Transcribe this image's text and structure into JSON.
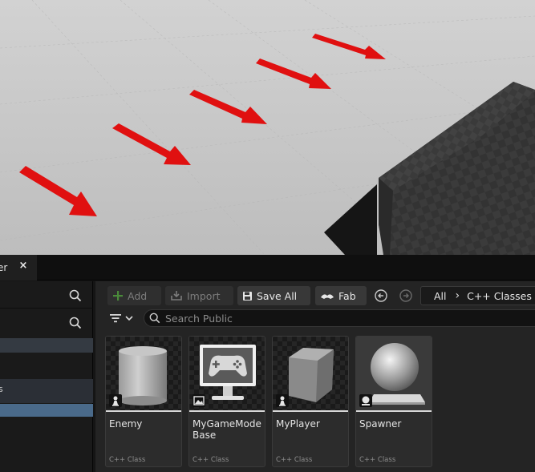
{
  "tab": {
    "label": "er",
    "close": "×"
  },
  "left_panel": {
    "item_label": "s"
  },
  "toolbar": {
    "add_label": "Add",
    "import_label": "Import",
    "save_all_label": "Save All",
    "fab_label": "Fab"
  },
  "path": {
    "root": "All",
    "current": "C++ Classes"
  },
  "search": {
    "placeholder": "Search Public",
    "value": ""
  },
  "assets": [
    {
      "name": "Enemy",
      "type": "C++ Class",
      "icon": "cylinder-pawn-icon"
    },
    {
      "name": "MyGameModeBase",
      "type": "C++ Class",
      "icon": "gamepad-monitor-icon"
    },
    {
      "name": "MyPlayer",
      "type": "C++ Class",
      "icon": "cube-pawn-icon"
    },
    {
      "name": "Spawner",
      "type": "C++ Class",
      "icon": "sphere-pedestal-icon"
    }
  ],
  "colors": {
    "viewport_floor": "#c8c8c8",
    "arrow": "#e01010",
    "panel_bg": "#242424",
    "selection": "#4a6a8a"
  }
}
